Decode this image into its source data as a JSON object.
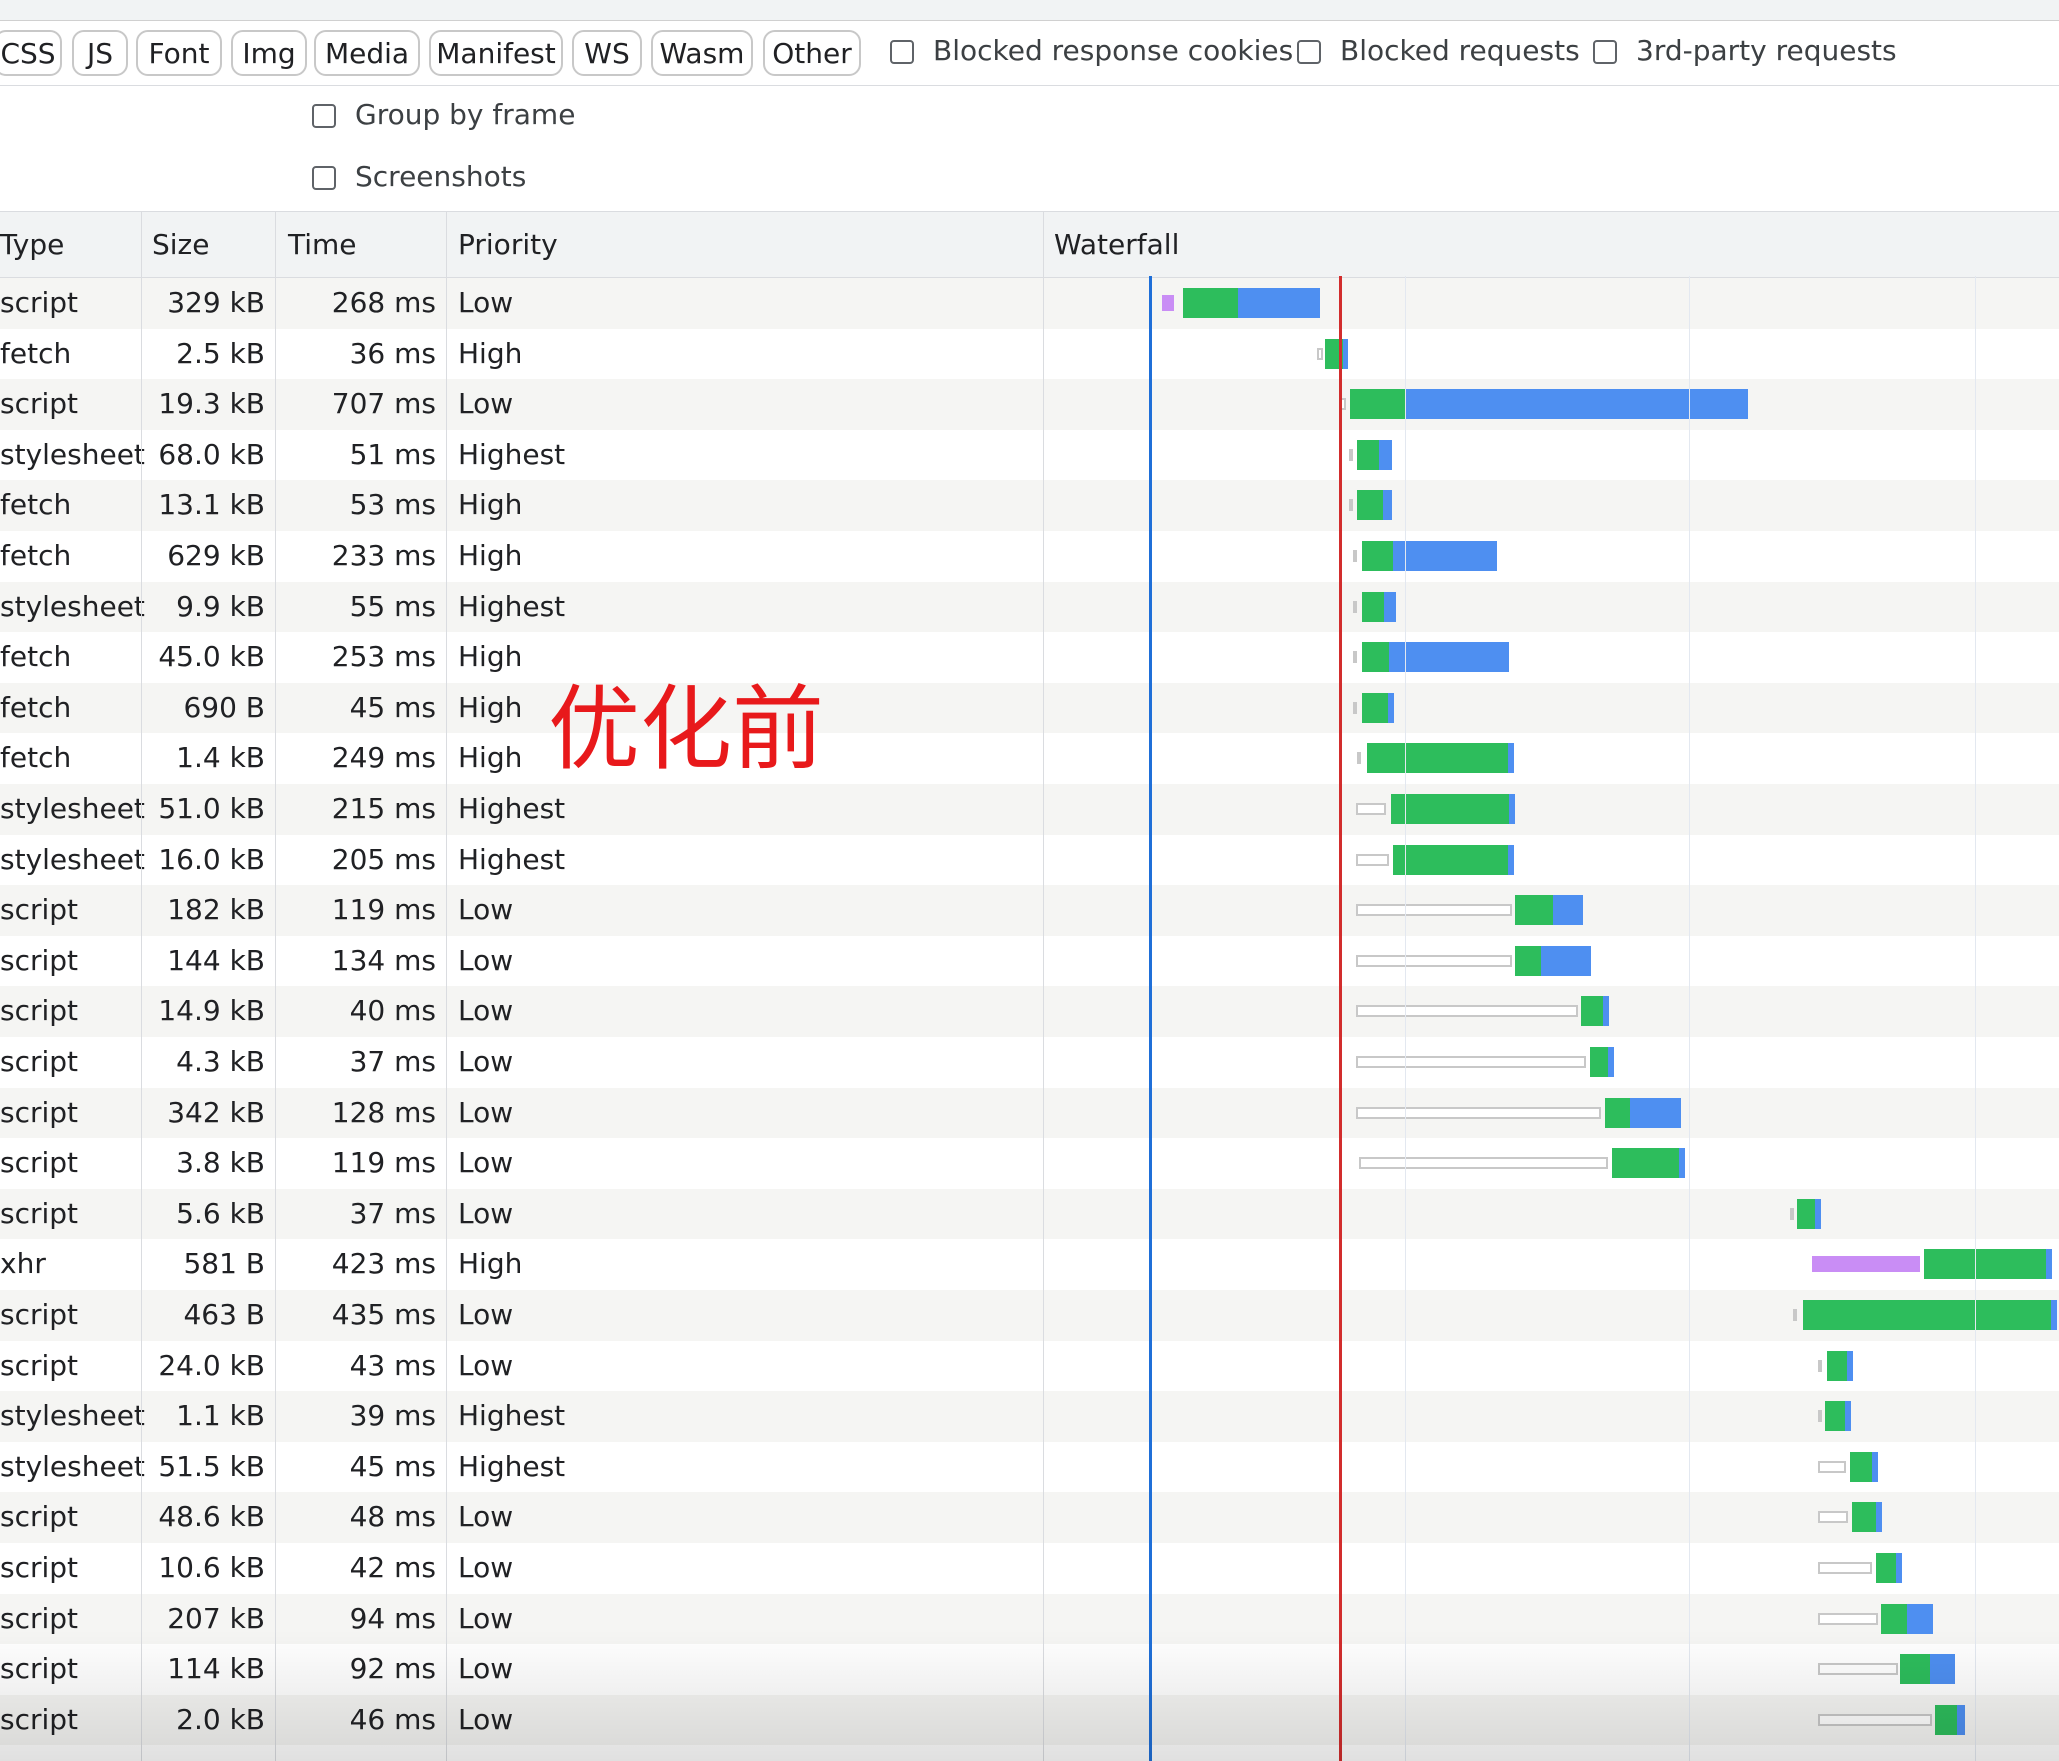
{
  "filters": {
    "chips": [
      "CSS",
      "JS",
      "Font",
      "Img",
      "Media",
      "Manifest",
      "WS",
      "Wasm",
      "Other"
    ],
    "checkboxes": [
      "Blocked response cookies",
      "Blocked requests",
      "3rd-party requests"
    ]
  },
  "settings": {
    "group_by_frame": "Group by frame",
    "screenshots": "Screenshots"
  },
  "columns": {
    "type": "Type",
    "size": "Size",
    "time": "Time",
    "priority": "Priority",
    "waterfall": "Waterfall"
  },
  "annotation": "优化前",
  "colors": {
    "connect": "#2dbd5c",
    "download": "#4e8ff1",
    "wait": "#c98df5",
    "dom_content_loaded": "#1f6fd8",
    "load": "#d22d2d"
  },
  "rows": [
    {
      "type": "script",
      "size": "329 kB",
      "time": "268 ms",
      "priority": "Low"
    },
    {
      "type": "fetch",
      "size": "2.5 kB",
      "time": "36 ms",
      "priority": "High"
    },
    {
      "type": "script",
      "size": "19.3 kB",
      "time": "707 ms",
      "priority": "Low"
    },
    {
      "type": "stylesheet",
      "size": "68.0 kB",
      "time": "51 ms",
      "priority": "Highest"
    },
    {
      "type": "fetch",
      "size": "13.1 kB",
      "time": "53 ms",
      "priority": "High"
    },
    {
      "type": "fetch",
      "size": "629 kB",
      "time": "233 ms",
      "priority": "High"
    },
    {
      "type": "stylesheet",
      "size": "9.9 kB",
      "time": "55 ms",
      "priority": "Highest"
    },
    {
      "type": "fetch",
      "size": "45.0 kB",
      "time": "253 ms",
      "priority": "High"
    },
    {
      "type": "fetch",
      "size": "690 B",
      "time": "45 ms",
      "priority": "High"
    },
    {
      "type": "fetch",
      "size": "1.4 kB",
      "time": "249 ms",
      "priority": "High"
    },
    {
      "type": "stylesheet",
      "size": "51.0 kB",
      "time": "215 ms",
      "priority": "Highest"
    },
    {
      "type": "stylesheet",
      "size": "16.0 kB",
      "time": "205 ms",
      "priority": "Highest"
    },
    {
      "type": "script",
      "size": "182 kB",
      "time": "119 ms",
      "priority": "Low"
    },
    {
      "type": "script",
      "size": "144 kB",
      "time": "134 ms",
      "priority": "Low"
    },
    {
      "type": "script",
      "size": "14.9 kB",
      "time": "40 ms",
      "priority": "Low"
    },
    {
      "type": "script",
      "size": "4.3 kB",
      "time": "37 ms",
      "priority": "Low"
    },
    {
      "type": "script",
      "size": "342 kB",
      "time": "128 ms",
      "priority": "Low"
    },
    {
      "type": "script",
      "size": "3.8 kB",
      "time": "119 ms",
      "priority": "Low"
    },
    {
      "type": "script",
      "size": "5.6 kB",
      "time": "37 ms",
      "priority": "Low"
    },
    {
      "type": "xhr",
      "size": "581 B",
      "time": "423 ms",
      "priority": "High"
    },
    {
      "type": "script",
      "size": "463 B",
      "time": "435 ms",
      "priority": "Low"
    },
    {
      "type": "script",
      "size": "24.0 kB",
      "time": "43 ms",
      "priority": "Low"
    },
    {
      "type": "stylesheet",
      "size": "1.1 kB",
      "time": "39 ms",
      "priority": "Highest"
    },
    {
      "type": "stylesheet",
      "size": "51.5 kB",
      "time": "45 ms",
      "priority": "Highest"
    },
    {
      "type": "script",
      "size": "48.6 kB",
      "time": "48 ms",
      "priority": "Low"
    },
    {
      "type": "script",
      "size": "10.6 kB",
      "time": "42 ms",
      "priority": "Low"
    },
    {
      "type": "script",
      "size": "207 kB",
      "time": "94 ms",
      "priority": "Low"
    },
    {
      "type": "script",
      "size": "114 kB",
      "time": "92 ms",
      "priority": "Low"
    },
    {
      "type": "script",
      "size": "2.0 kB",
      "time": "46 ms",
      "priority": "Low"
    }
  ]
}
